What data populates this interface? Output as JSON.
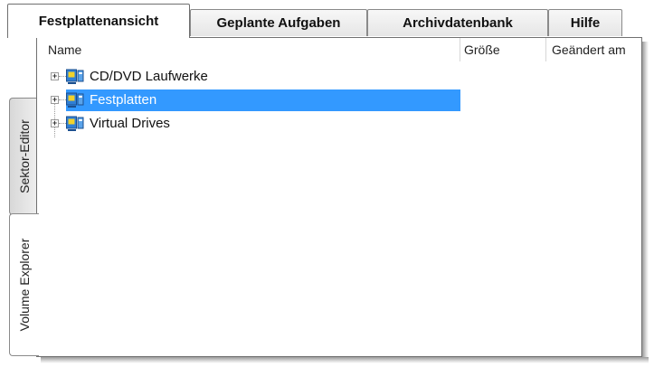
{
  "tabs": [
    {
      "label": "Festplattenansicht",
      "active": true
    },
    {
      "label": "Geplante Aufgaben",
      "active": false
    },
    {
      "label": "Archivdatenbank",
      "active": false
    },
    {
      "label": "Hilfe",
      "active": false
    }
  ],
  "side_tabs": [
    {
      "label": "Sektor-Editor",
      "active": false
    },
    {
      "label": "Volume Explorer",
      "active": true
    }
  ],
  "columns": {
    "name": "Name",
    "size": "Größe",
    "modified": "Geändert am"
  },
  "tree": [
    {
      "label": "CD/DVD Laufwerke",
      "expander": "+",
      "selected": false,
      "icon": "drive-group-icon"
    },
    {
      "label": "Festplatten",
      "expander": "+",
      "selected": true,
      "icon": "drive-group-icon"
    },
    {
      "label": "Virtual Drives",
      "expander": "+",
      "selected": false,
      "icon": "drive-group-icon"
    }
  ],
  "colors": {
    "selection": "#3399ff",
    "icon_blue": "#2f7fd6",
    "icon_yellow": "#f2d22b"
  }
}
